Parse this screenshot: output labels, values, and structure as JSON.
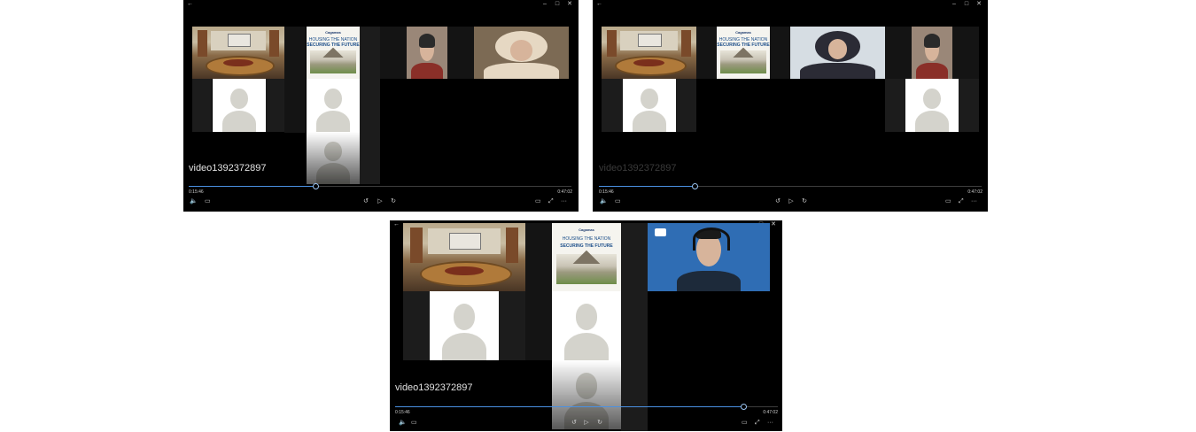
{
  "players": [
    {
      "title": "video1392372897",
      "current_time": "0:15:46",
      "duration": "0:47:02",
      "progress": 0.33,
      "tiles": [
        {
          "kind": "room"
        },
        {
          "kind": "poster"
        },
        {
          "kind": "person-red"
        },
        {
          "kind": "person-hijab"
        },
        {
          "kind": "avatar"
        },
        {
          "kind": "avatar"
        },
        {
          "kind": "avatar-faded"
        }
      ]
    },
    {
      "title": "video1392372897",
      "current_time": "0:15:46",
      "duration": "0:47:02",
      "progress": 0.25,
      "tiles": [
        {
          "kind": "room"
        },
        {
          "kind": "poster"
        },
        {
          "kind": "person-whitebg"
        },
        {
          "kind": "person-red"
        },
        {
          "kind": "avatar"
        },
        {
          "kind": "avatar"
        }
      ]
    },
    {
      "title": "video1392372897",
      "current_time": "0:15:46",
      "duration": "0:47:02",
      "progress": 0.91,
      "tiles": [
        {
          "kind": "room"
        },
        {
          "kind": "poster"
        },
        {
          "kind": "person-headset"
        },
        {
          "kind": "avatar"
        },
        {
          "kind": "avatar"
        },
        {
          "kind": "avatar-faded"
        }
      ]
    }
  ],
  "poster": {
    "logo": "Cagamas",
    "line1": "HOUSING THE NATION",
    "line2": "SECURING THE FUTURE"
  },
  "icons": {
    "back": "back-arrow-icon",
    "minimize": "minimize-icon",
    "maximize": "maximize-icon",
    "close": "close-icon",
    "volume": "volume-icon",
    "captions": "captions-icon",
    "rewind": "rewind-10-icon",
    "play": "play-icon",
    "forward": "forward-30-icon",
    "miniview": "mini-view-icon",
    "fullscreen": "fullscreen-icon",
    "more": "more-icon"
  },
  "glyphs": {
    "back": "←",
    "minimize": "–",
    "maximize": "□",
    "close": "✕",
    "volume": "🔈",
    "captions": "▭",
    "rewind": "↺",
    "play": "▷",
    "forward": "↻",
    "miniview": "▭",
    "fullscreen": "⤢",
    "more": "···"
  },
  "colors": {
    "accent": "#4a90e2",
    "player_bg": "#000000",
    "avatar_bg": "#ffffff",
    "avatar_fg": "#d4d3cc"
  }
}
